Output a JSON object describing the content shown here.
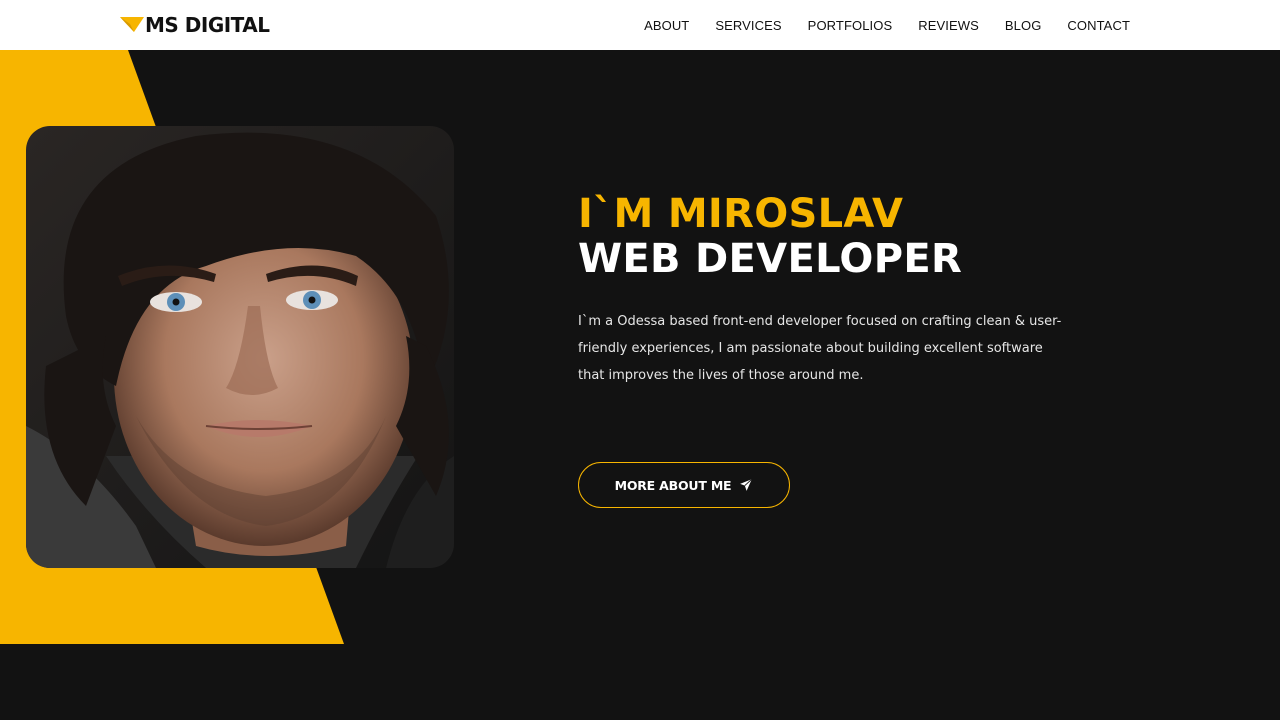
{
  "brand": {
    "name": "MS DIGITAL",
    "accent": "#f7b500",
    "logo_icon": "yellow-arrow-logo-icon"
  },
  "nav": {
    "items": [
      {
        "label": "ABOUT"
      },
      {
        "label": "SERVICES"
      },
      {
        "label": "PORTFOLIOS"
      },
      {
        "label": "REVIEWS"
      },
      {
        "label": "BLOG"
      },
      {
        "label": "CONTACT"
      }
    ]
  },
  "hero": {
    "title_line1": "I`M MIROSLAV",
    "title_line2": "WEB DEVELOPER",
    "description": "I`m a Odessa based front-end developer focused on crafting clean & user-friendly experiences, I am passionate about building excellent software that improves the lives of those around me.",
    "cta_label": "MORE ABOUT ME",
    "cta_icon": "paper-plane-icon",
    "background": "#121212"
  }
}
